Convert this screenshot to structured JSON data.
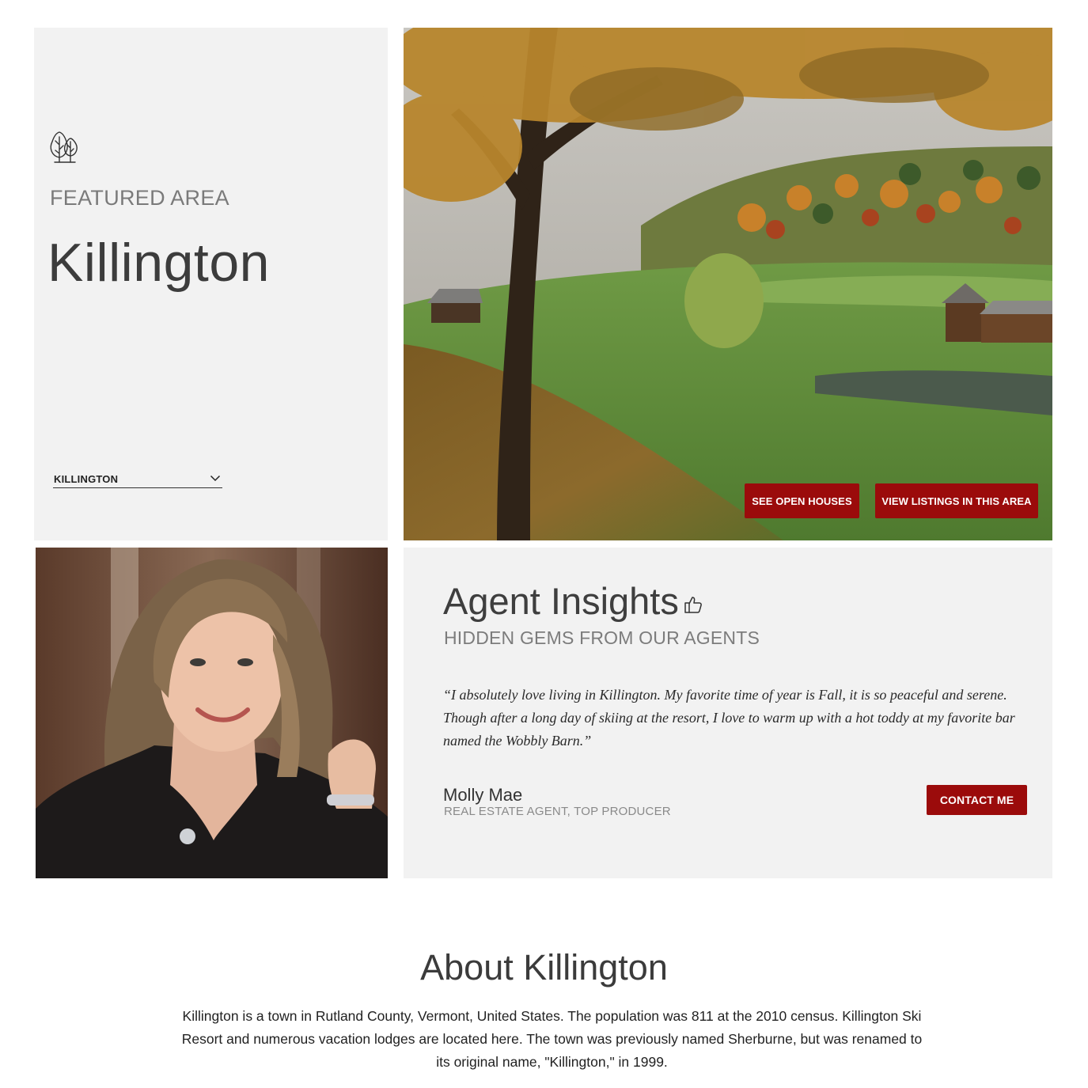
{
  "featured": {
    "icon": "trees-icon",
    "eyebrow": "FEATURED AREA",
    "title": "Killington",
    "area_select": {
      "value": "KILLINGTON",
      "icon": "chevron-down-icon"
    }
  },
  "hero": {
    "buttons": {
      "open_houses": "SEE OPEN HOUSES",
      "view_listings": "VIEW LISTINGS IN THIS AREA"
    }
  },
  "insights": {
    "title": "Agent Insights",
    "icon": "thumbs-up-icon",
    "subtitle": "HIDDEN GEMS FROM OUR AGENTS",
    "quote": "“I absolutely love living in Killington. My favorite time of year is Fall, it is so peaceful and serene. Though after a long day of skiing at the resort, I love to warm up with a hot toddy at my favorite bar named the Wobbly Barn.”",
    "agent_name": "Molly Mae",
    "agent_role": "REAL ESTATE AGENT, TOP PRODUCER",
    "contact_label": "CONTACT ME"
  },
  "about": {
    "title": "About Killington",
    "body": "Killington is a town in Rutland County, Vermont, United States. The population was 811 at the 2010 census. Killington Ski Resort and numerous vacation lodges are located here. The town was previously named Sherburne, but was renamed to its original name, \"Killington,\" in 1999."
  },
  "colors": {
    "accent": "#9b0b0b",
    "panel_bg": "#f2f2f2"
  }
}
